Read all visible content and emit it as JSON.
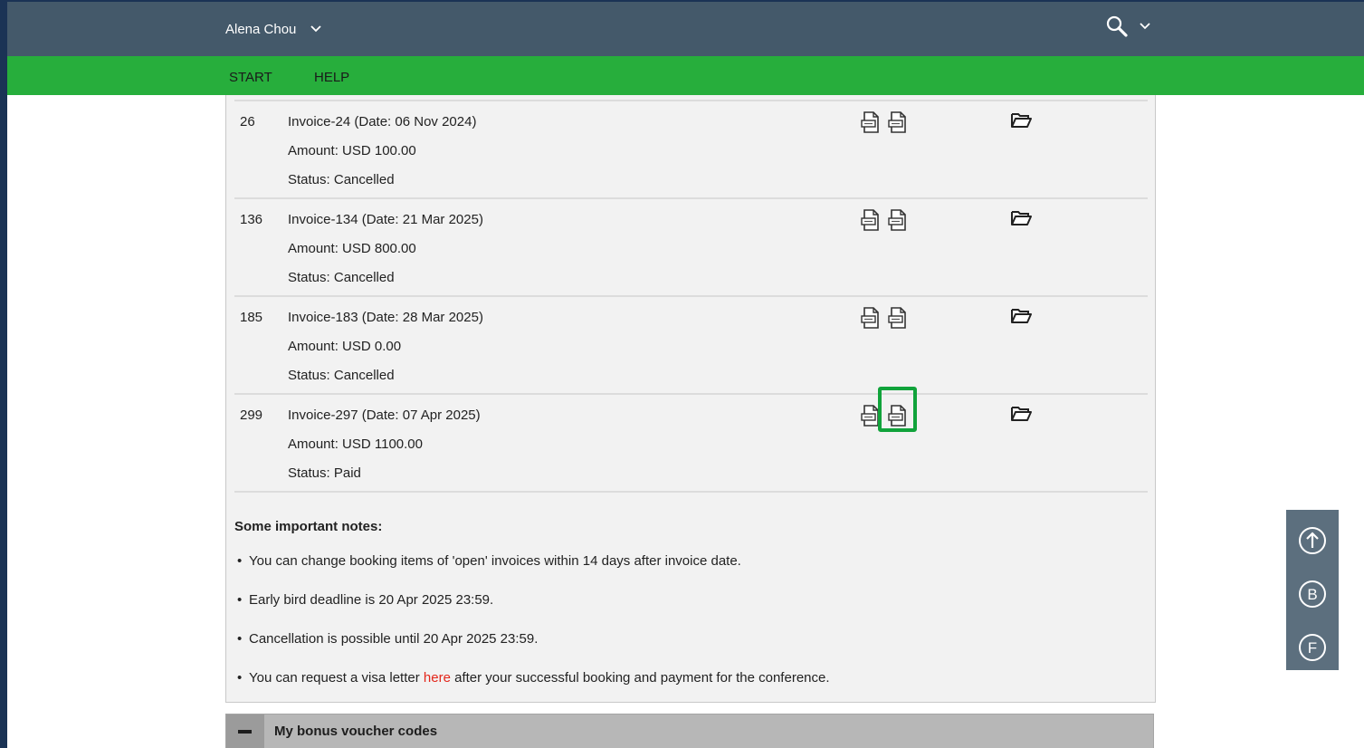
{
  "header": {
    "user_name": "Alena Chou",
    "user_menu_icon": "chevron-down-icon",
    "search_icon": "search-icon",
    "search_menu_icon": "chevron-down-icon"
  },
  "nav": {
    "items": [
      {
        "label": "START"
      },
      {
        "label": "HELP"
      }
    ]
  },
  "invoices": [
    {
      "number": "26",
      "title": "Invoice-24 (Date: 06 Nov 2024)",
      "amount": "Amount: USD 100.00",
      "status": "Status: Cancelled"
    },
    {
      "number": "136",
      "title": "Invoice-134 (Date: 21 Mar 2025)",
      "amount": "Amount: USD 800.00",
      "status": "Status: Cancelled"
    },
    {
      "number": "185",
      "title": "Invoice-183 (Date: 28 Mar 2025)",
      "amount": "Amount: USD 0.00",
      "status": "Status: Cancelled"
    },
    {
      "number": "299",
      "title": "Invoice-297 (Date: 07 Apr 2025)",
      "amount": "Amount: USD 1100.00",
      "status": "Status: Paid"
    }
  ],
  "invoice_icons": [
    "pdf-document-icon",
    "pdf-document-icon",
    "folder-open-icon"
  ],
  "highlight_color": "#11a33b",
  "notes": {
    "title": "Some important notes:",
    "items": [
      "You can change booking items of 'open' invoices within 14 days after invoice date.",
      "Early bird deadline is 20 Apr 2025 23:59.",
      "Cancellation is possible until 20 Apr 2025 23:59."
    ],
    "visa": {
      "before": "You can request a visa letter ",
      "link": "here",
      "after": " after your successful booking and payment for the conference."
    }
  },
  "voucher": {
    "title": "My bonus voucher codes",
    "toggle_icon": "minus-icon"
  },
  "float_buttons": [
    {
      "label": "↑",
      "icon": "scroll-up-icon"
    },
    {
      "label": "B",
      "icon": "b-circle-icon"
    },
    {
      "label": "F",
      "icon": "f-circle-icon"
    }
  ],
  "colors": {
    "header_bg": "#44596a",
    "nav_bg": "#27ae3c",
    "link": "#e3261b",
    "float_bg": "#5c6f7e"
  }
}
